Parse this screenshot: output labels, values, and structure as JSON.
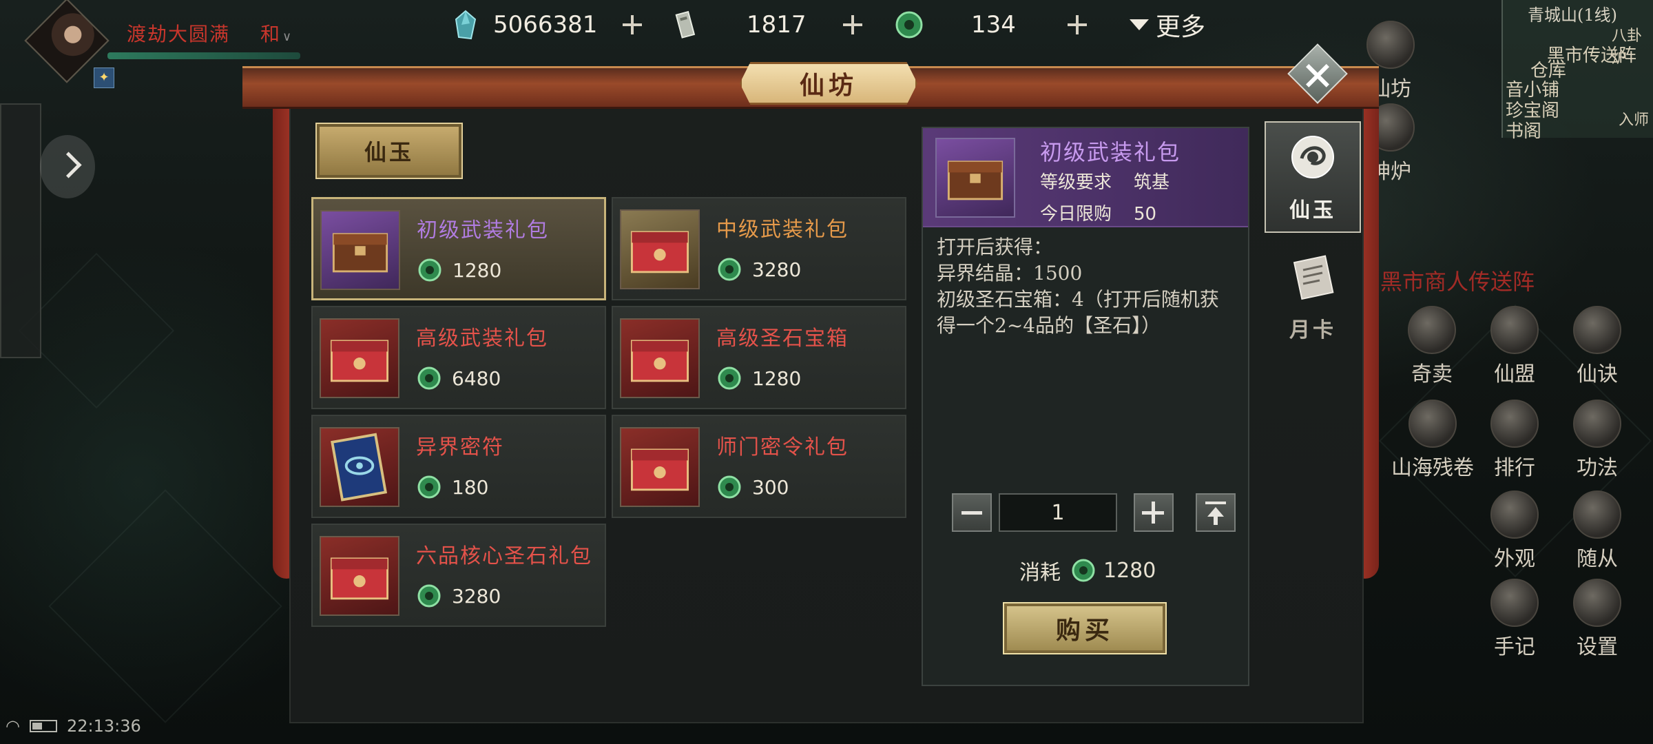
{
  "player": {
    "title": "渡劫大圆满",
    "mode": "和"
  },
  "currencies": [
    {
      "icon": "crystal-icon",
      "amount": "5066381"
    },
    {
      "icon": "token-icon",
      "amount": "1817"
    },
    {
      "icon": "jade-icon",
      "amount": "134"
    }
  ],
  "more_label": "更多",
  "map": {
    "title": "青城山(1线)",
    "labels": [
      "八卦炉",
      "黑市传送阵",
      "仓库",
      "音小铺",
      "珍宝阁",
      "书阁",
      "入师"
    ]
  },
  "side_menu": [
    "奇卖",
    "仙盟",
    "仙诀",
    "山海残卷",
    "排行",
    "功法",
    "外观",
    "随从",
    "手记",
    "设置"
  ],
  "side_menu_top": [
    "仙坊",
    "神炉"
  ],
  "black_market": "黑市商人传送阵",
  "clock": "22:13:36",
  "shop": {
    "title": "仙坊",
    "category": "仙玉",
    "items": [
      {
        "name": "初级武装礼包",
        "price": "1280",
        "color": "purple",
        "selected": true
      },
      {
        "name": "中级武装礼包",
        "price": "3280",
        "color": "orange",
        "selected": false
      },
      {
        "name": "高级武装礼包",
        "price": "6480",
        "color": "red",
        "selected": false
      },
      {
        "name": "高级圣石宝箱",
        "price": "1280",
        "color": "red",
        "selected": false
      },
      {
        "name": "异界密符",
        "price": "180",
        "color": "red",
        "selected": false
      },
      {
        "name": "师门密令礼包",
        "price": "300",
        "color": "red",
        "selected": false
      },
      {
        "name": "六品核心圣石礼包",
        "price": "3280",
        "color": "red",
        "selected": false
      }
    ],
    "detail": {
      "name": "初级武装礼包",
      "level_label": "等级要求",
      "level_value": "筑基",
      "limit_label": "今日限购",
      "limit_value": "50",
      "description": "打开后获得：\n异界结晶：1500\n初级圣石宝箱：4（打开后随机获得一个2~4品的【圣石】）",
      "quantity": "1",
      "cost_label": "消耗",
      "cost_value": "1280",
      "buy_label": "购买"
    },
    "tabs": [
      {
        "label": "仙玉",
        "icon": "jade-dragon-icon",
        "active": true
      },
      {
        "label": "月卡",
        "icon": "scroll-book-icon",
        "active": false
      }
    ]
  },
  "colors": {
    "purple": "#b07ce0",
    "orange": "#e69a4a",
    "red": "#e4524a",
    "gold": "#c8b47a"
  }
}
